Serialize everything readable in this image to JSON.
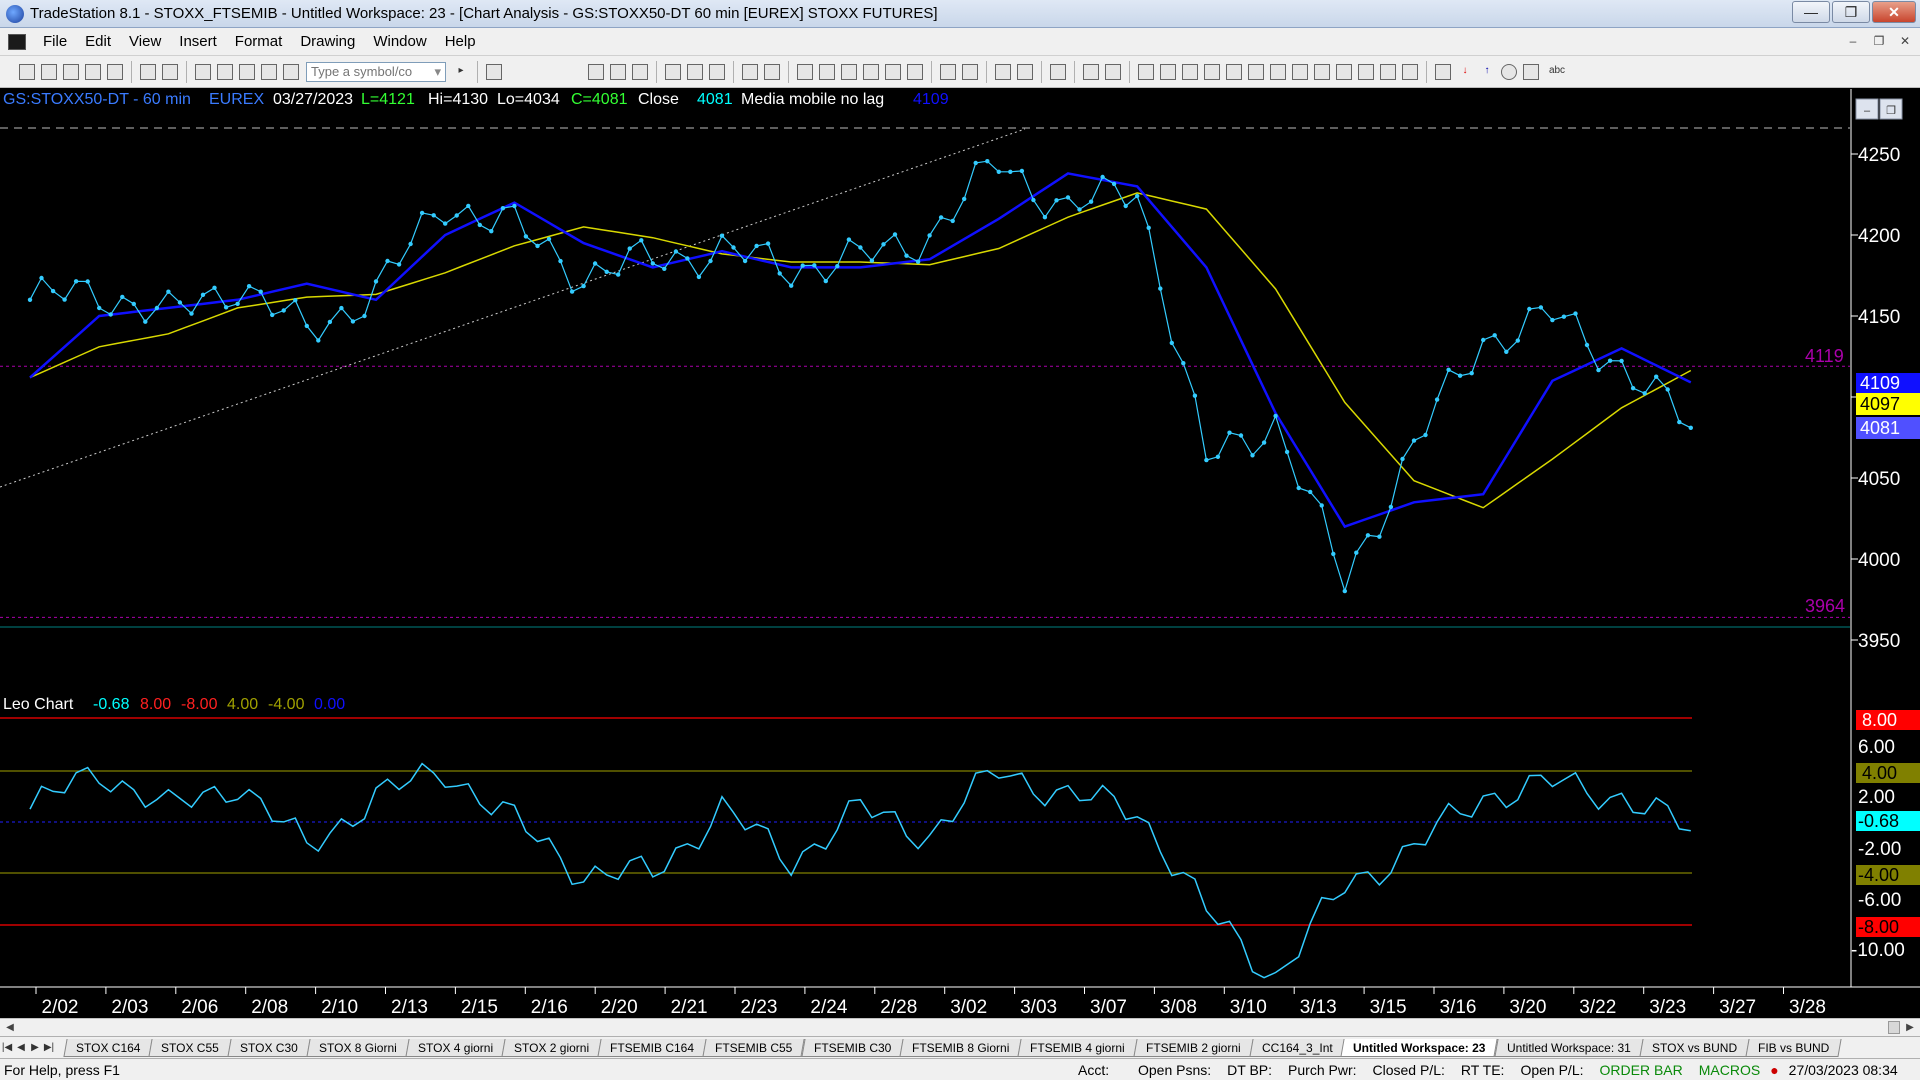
{
  "window": {
    "title": "TradeStation 8.1 - STOXX_FTSEMIB - Untitled Workspace:  23 - [Chart Analysis - GS:STOXX50-DT  60 min  [EUREX] STOXX FUTURES]"
  },
  "menu": [
    "File",
    "Edit",
    "View",
    "Insert",
    "Format",
    "Drawing",
    "Window",
    "Help"
  ],
  "toolbar": {
    "symbol_placeholder": "Type a symbol/co"
  },
  "chart": {
    "header": {
      "symbol": "GS:STOXX50-DT - 60 min",
      "exchange": "EUREX",
      "date": "03/27/2023",
      "last": "L=4121",
      "high": "Hi=4130",
      "low": "Lo=4034",
      "close": "C=4081",
      "close_label": "Close",
      "close_value": "4081",
      "indicator_name": "Media mobile no lag",
      "indicator_value": "4109"
    },
    "price_axis_ticks": [
      "4250",
      "4200",
      "4150",
      "4100",
      "4050",
      "4000",
      "3950"
    ],
    "price_level_labels": {
      "high": "4119",
      "low": "3964"
    },
    "price_tags": {
      "blue": "4109",
      "yellow": "4097",
      "close": "4081"
    },
    "osc_header": {
      "name": "Leo Chart",
      "v1": "-0.68",
      "v2": "8.00",
      "v3": "-8.00",
      "v4": "4.00",
      "v5": "-4.00",
      "v6": "0.00"
    },
    "osc_axis_ticks": [
      "6.00",
      "2.00",
      "-2.00",
      "-6.00",
      "-10.00"
    ],
    "osc_tags": {
      "red_top": "8.00",
      "olive_top": "4.00",
      "current": "-0.68",
      "olive_bottom": "-4.00",
      "red_bottom": "-8.00"
    },
    "date_labels": [
      "2/02",
      "2/03",
      "2/06",
      "2/08",
      "2/10",
      "2/13",
      "2/15",
      "2/16",
      "2/20",
      "2/21",
      "2/23",
      "2/24",
      "2/28",
      "3/02",
      "3/03",
      "3/07",
      "3/08",
      "3/10",
      "3/13",
      "3/15",
      "3/16",
      "3/20",
      "3/22",
      "3/23",
      "3/27",
      "3/28"
    ],
    "colors": {
      "price": "#33ccff",
      "fast_ma": "#1010ff",
      "slow_ma": "#d8d800",
      "levels": "#aa00aa",
      "osc": "#33ccff",
      "red_band": "#ff0000",
      "olive_band": "#808000"
    }
  },
  "chart_data": [
    {
      "type": "line",
      "title": "GS:STOXX50-DT - 60 min",
      "x": [
        "2/02",
        "2/03",
        "2/06",
        "2/08",
        "2/10",
        "2/13",
        "2/15",
        "2/16",
        "2/20",
        "2/21",
        "2/23",
        "2/24",
        "2/28",
        "3/02",
        "3/03",
        "3/07",
        "3/08",
        "3/10",
        "3/13",
        "3/15",
        "3/16",
        "3/20",
        "3/22",
        "3/23",
        "3/27"
      ],
      "series": [
        {
          "name": "Close",
          "values": [
            4160,
            4165,
            4150,
            4170,
            4140,
            4165,
            4220,
            4205,
            4175,
            4185,
            4190,
            4180,
            4185,
            4200,
            4245,
            4215,
            4230,
            4060,
            4085,
            3985,
            4070,
            4135,
            4150,
            4120,
            4081
          ]
        },
        {
          "name": "Media mobile no lag",
          "values": [
            4112,
            4150,
            4155,
            4160,
            4170,
            4160,
            4200,
            4220,
            4195,
            4180,
            4190,
            4180,
            4180,
            4185,
            4210,
            4238,
            4230,
            4180,
            4090,
            4020,
            4035,
            4040,
            4110,
            4130,
            4109
          ]
        }
      ],
      "ylim": [
        3925,
        4275
      ],
      "levels": [
        4119,
        3964
      ]
    },
    {
      "type": "line",
      "title": "Leo Chart",
      "series": [
        {
          "name": "Leo Chart",
          "values": [
            1,
            4,
            1,
            3,
            -2,
            2,
            4,
            0,
            -4,
            -4,
            1,
            -3,
            1,
            -1,
            4,
            2,
            1,
            -7,
            -12,
            -5,
            -2,
            2,
            3,
            2,
            -0.68
          ]
        }
      ],
      "ylim": [
        -12,
        10
      ],
      "bands": [
        8,
        4,
        0,
        -4,
        -8
      ]
    }
  ],
  "tabs": [
    "STOX C164",
    "STOX C55",
    "STOX  C30",
    "STOX  8 Giorni",
    "STOX 4 giorni",
    "STOX  2 giorni",
    "FTSEMIB C164",
    "FTSEMIB C55",
    "FTSEMIB C30",
    "FTSEMIB  8 Giorni",
    "FTSEMIB  4 giorni",
    "FTSEMIB  2 giorni",
    "CC164_3_Int",
    "Untitled Workspace:  23",
    "Untitled Workspace:  31",
    "STOX vs BUND",
    "FIB vs BUND"
  ],
  "active_tab": "Untitled Workspace:  23",
  "status": {
    "help": "For Help, press F1",
    "acct": "Acct:",
    "open_psns": "Open Psns:",
    "dt_bp": "DT BP:",
    "purch_pwr": "Purch Pwr:",
    "closed_pl": "Closed P/L:",
    "rt_te": "RT TE:",
    "open_pl": "Open P/L:",
    "order_bar": "ORDER BAR",
    "macros": "MACROS",
    "clock": "27/03/2023 08:34"
  }
}
